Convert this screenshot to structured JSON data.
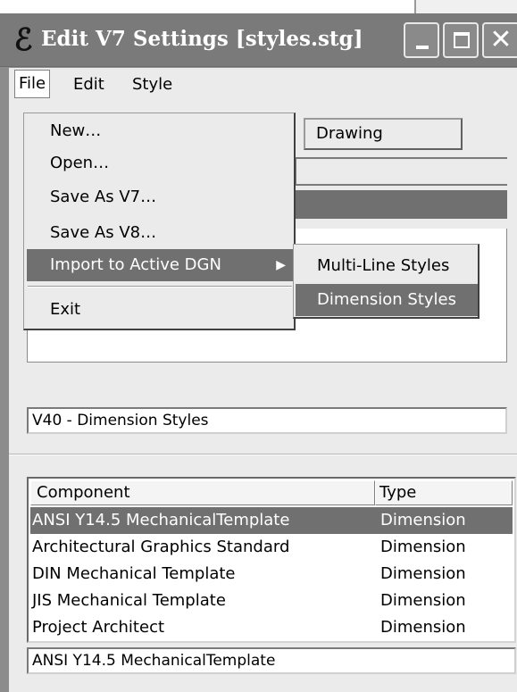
{
  "window": {
    "title": "Edit V7 Settings [styles.stg]",
    "app_icon": "ℰ"
  },
  "menubar": {
    "file": "File",
    "edit": "Edit",
    "style": "Style"
  },
  "file_menu": {
    "items": [
      "New…",
      "Open…",
      "Save As V7…",
      "Save As V8…",
      "Import to Active DGN",
      "Exit"
    ]
  },
  "import_submenu": {
    "items": [
      "Multi-Line Styles",
      "Dimension Styles"
    ]
  },
  "content": {
    "drawing_button": "Drawing",
    "category_name": "V40 - Dimension Styles"
  },
  "components": {
    "headers": [
      "Component",
      "Type"
    ],
    "rows": [
      {
        "name": "ANSI Y14.5 MechanicalTemplate",
        "type": "Dimension"
      },
      {
        "name": "Architectural Graphics Standard",
        "type": "Dimension"
      },
      {
        "name": "DIN Mechanical Template",
        "type": "Dimension"
      },
      {
        "name": "JIS Mechanical Template",
        "type": "Dimension"
      },
      {
        "name": "Project Architect",
        "type": "Dimension"
      }
    ],
    "selected_name": "ANSI Y14.5 MechanicalTemplate"
  },
  "colors": {
    "title_bar": "#7a7a7a",
    "highlight": "#707070",
    "face": "#ebebeb"
  }
}
